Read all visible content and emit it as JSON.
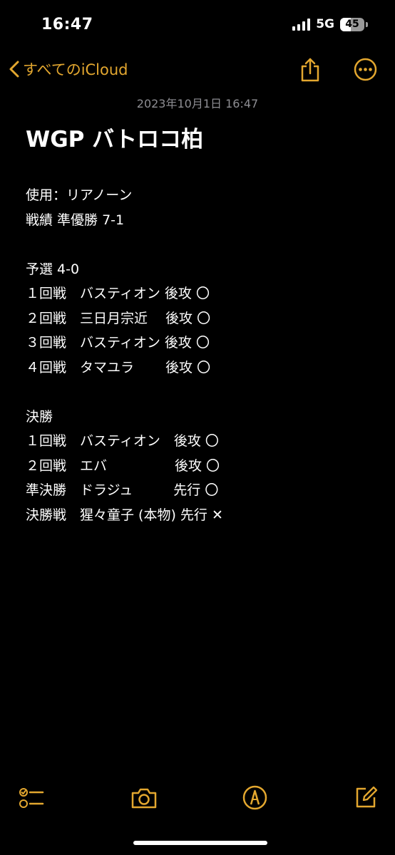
{
  "status_bar": {
    "time": "16:47",
    "network": "5G",
    "battery_level": "45",
    "battery_fraction": 0.45
  },
  "nav": {
    "back_label": "すべてのiCloud",
    "back_icon": "chevron-left-icon",
    "share_icon": "share-icon",
    "more_icon": "ellipsis-circle-icon"
  },
  "note": {
    "date": "2023年10月1日 16:47",
    "title": "WGP バトロコ柏",
    "lines": [
      "使用：リアノーン",
      "戦績 準優勝 7-1",
      "",
      "予選 4-0",
      "１回戦　バスティオン 後攻 〇",
      "２回戦　三日月宗近　 後攻 〇",
      "３回戦　バスティオン 後攻 〇",
      "４回戦　タマユラ　　 後攻 〇",
      "",
      "決勝",
      "１回戦　バスティオン　後攻 〇",
      "２回戦　エバ　　　　　後攻 〇",
      "準決勝　ドラジュ　　　先行 〇",
      "決勝戦　猩々童子 (本物) 先行 ✕"
    ]
  },
  "toolbar": {
    "checklist_icon": "checklist-icon",
    "camera_icon": "camera-icon",
    "markup_icon": "markup-pen-icon",
    "compose_icon": "compose-icon"
  },
  "colors": {
    "background": "#000000",
    "accent": "#e3a72f",
    "text": "#ffffff",
    "secondary_text": "#8e8e93"
  }
}
